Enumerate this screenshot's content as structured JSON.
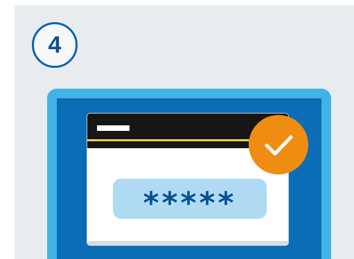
{
  "step": {
    "number": "4"
  },
  "password_field": {
    "masked_value": "*****"
  },
  "icons": {
    "step_badge": "circle-badge",
    "success": "checkmark-icon"
  },
  "colors": {
    "panel_background": "#e9ecef",
    "step_badge_border": "#0a63b0",
    "device_frame": "#41b3e6",
    "device_screen": "#0b6db5",
    "titlebar": "#161616",
    "titlebar_accent": "#f2d23a",
    "password_field": "#aedaf3",
    "password_mask": "#0a4f93",
    "success_badge": "#ef8d12"
  }
}
